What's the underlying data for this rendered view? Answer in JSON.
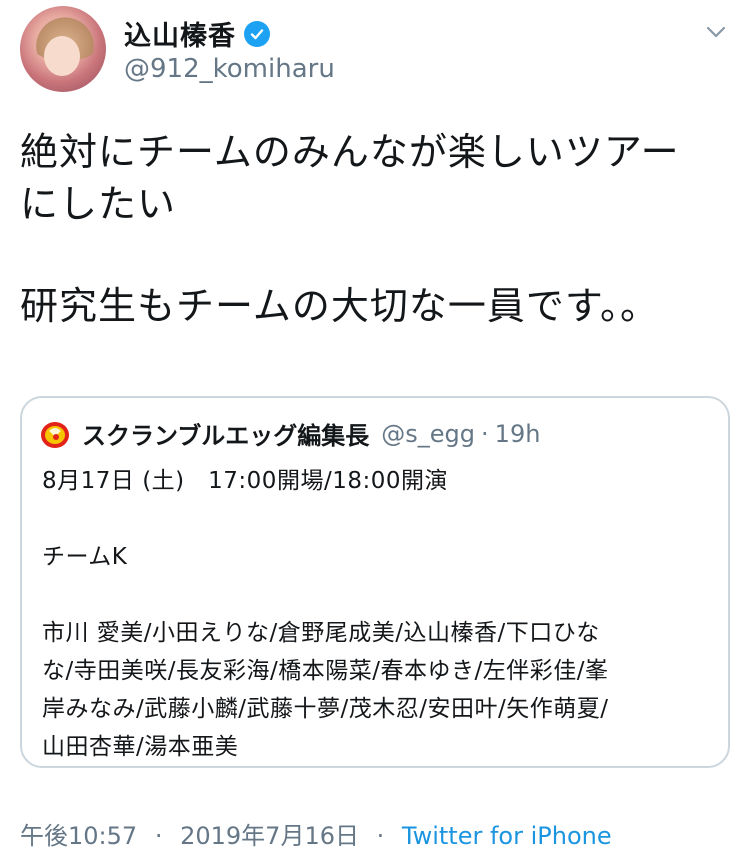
{
  "author": {
    "display_name": "込山榛香",
    "handle": "@912_komiharu"
  },
  "tweet": {
    "lines": [
      "絶対にチームのみんなが楽しいツアー",
      "にしたい",
      "",
      "研究生もチームの大切な一員です。。"
    ]
  },
  "quote": {
    "display_name": "スクランブルエッグ編集長",
    "handle": "@s_egg",
    "separator": "·",
    "time": "19h",
    "lines": [
      "8月17日 (土)　17:00開場/18:00開演",
      "",
      "チームK",
      "",
      "市川 愛美/小田えりな/倉野尾成美/込山榛香/下口ひな",
      "な/寺田美咲/長友彩海/橋本陽菜/春本ゆき/左伴彩佳/峯",
      "岸みなみ/武藤小麟/武藤十夢/茂木忍/安田叶/矢作萌夏/",
      "山田杏華/湯本亜美"
    ]
  },
  "footer": {
    "time": "午後10:57",
    "separator": "·",
    "date": "2019年7月16日",
    "source": "Twitter for iPhone"
  },
  "colors": {
    "text": "#14171a",
    "secondary": "#657786",
    "link": "#1b95e0",
    "verified": "#1da1f2",
    "border": "#ccd6dd"
  },
  "icons": {
    "verified": "verified-badge-icon",
    "menu": "chevron-down-icon",
    "quote_avatar": "egg-logo-icon"
  }
}
